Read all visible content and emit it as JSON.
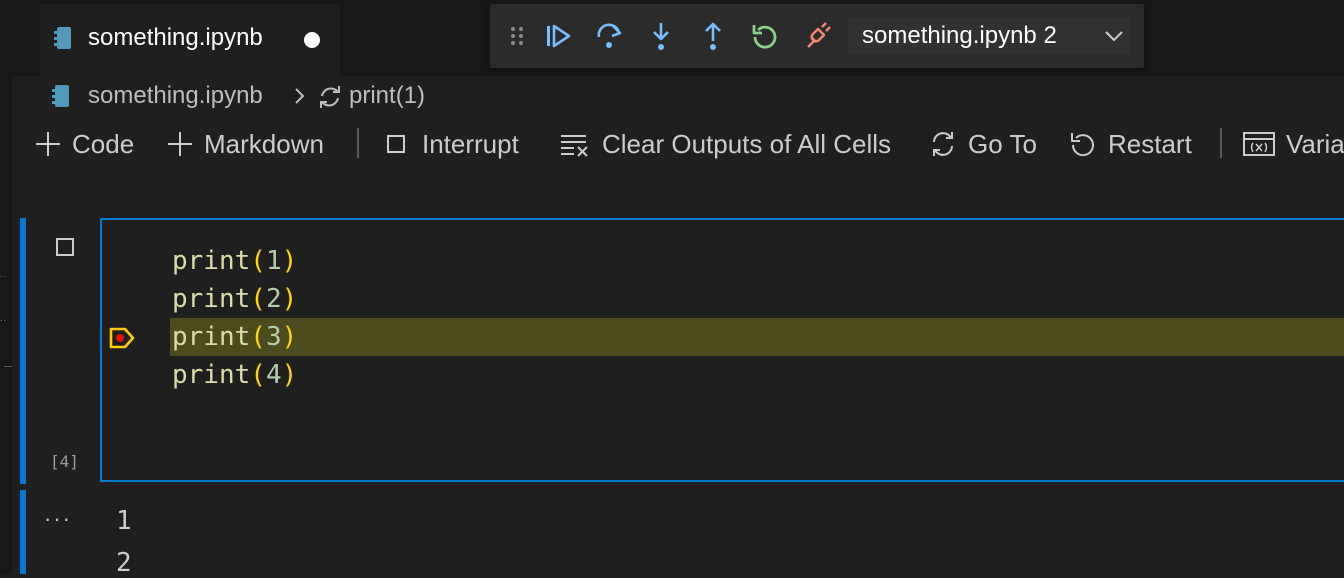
{
  "tab": {
    "label": "something.ipynb",
    "dirty_indicator": "●"
  },
  "debug_toolbar": {
    "buttons": [
      "gripper",
      "continue",
      "step-over",
      "step-into",
      "step-out",
      "restart",
      "disconnect"
    ],
    "session_label": "something.ipynb 2"
  },
  "breadcrumb": {
    "file": "something.ipynb",
    "symbol": "print(1)"
  },
  "notebook_toolbar": {
    "code": "Code",
    "markdown": "Markdown",
    "interrupt": "Interrupt",
    "clear_outputs": "Clear Outputs of All Cells",
    "go_to": "Go To",
    "restart": "Restart",
    "variables": "Varia"
  },
  "cell": {
    "execution_count": "[4]",
    "lines": [
      {
        "fn": "print",
        "open": "(",
        "arg": "1",
        "close": ")"
      },
      {
        "fn": "print",
        "open": "(",
        "arg": "2",
        "close": ")"
      },
      {
        "fn": "print",
        "open": "(",
        "arg": "3",
        "close": ")"
      },
      {
        "fn": "print",
        "open": "(",
        "arg": "4",
        "close": ")"
      }
    ],
    "current_line": 3
  },
  "output": {
    "more": "···",
    "lines": [
      "1",
      "2"
    ]
  },
  "colors": {
    "accent": "#0078d4",
    "debug_blue": "#75beff",
    "debug_green": "#89d185",
    "debug_red": "#f48771",
    "breakpoint_yellow": "#ffcc00",
    "current_line_bg": "#4b4b1e"
  }
}
